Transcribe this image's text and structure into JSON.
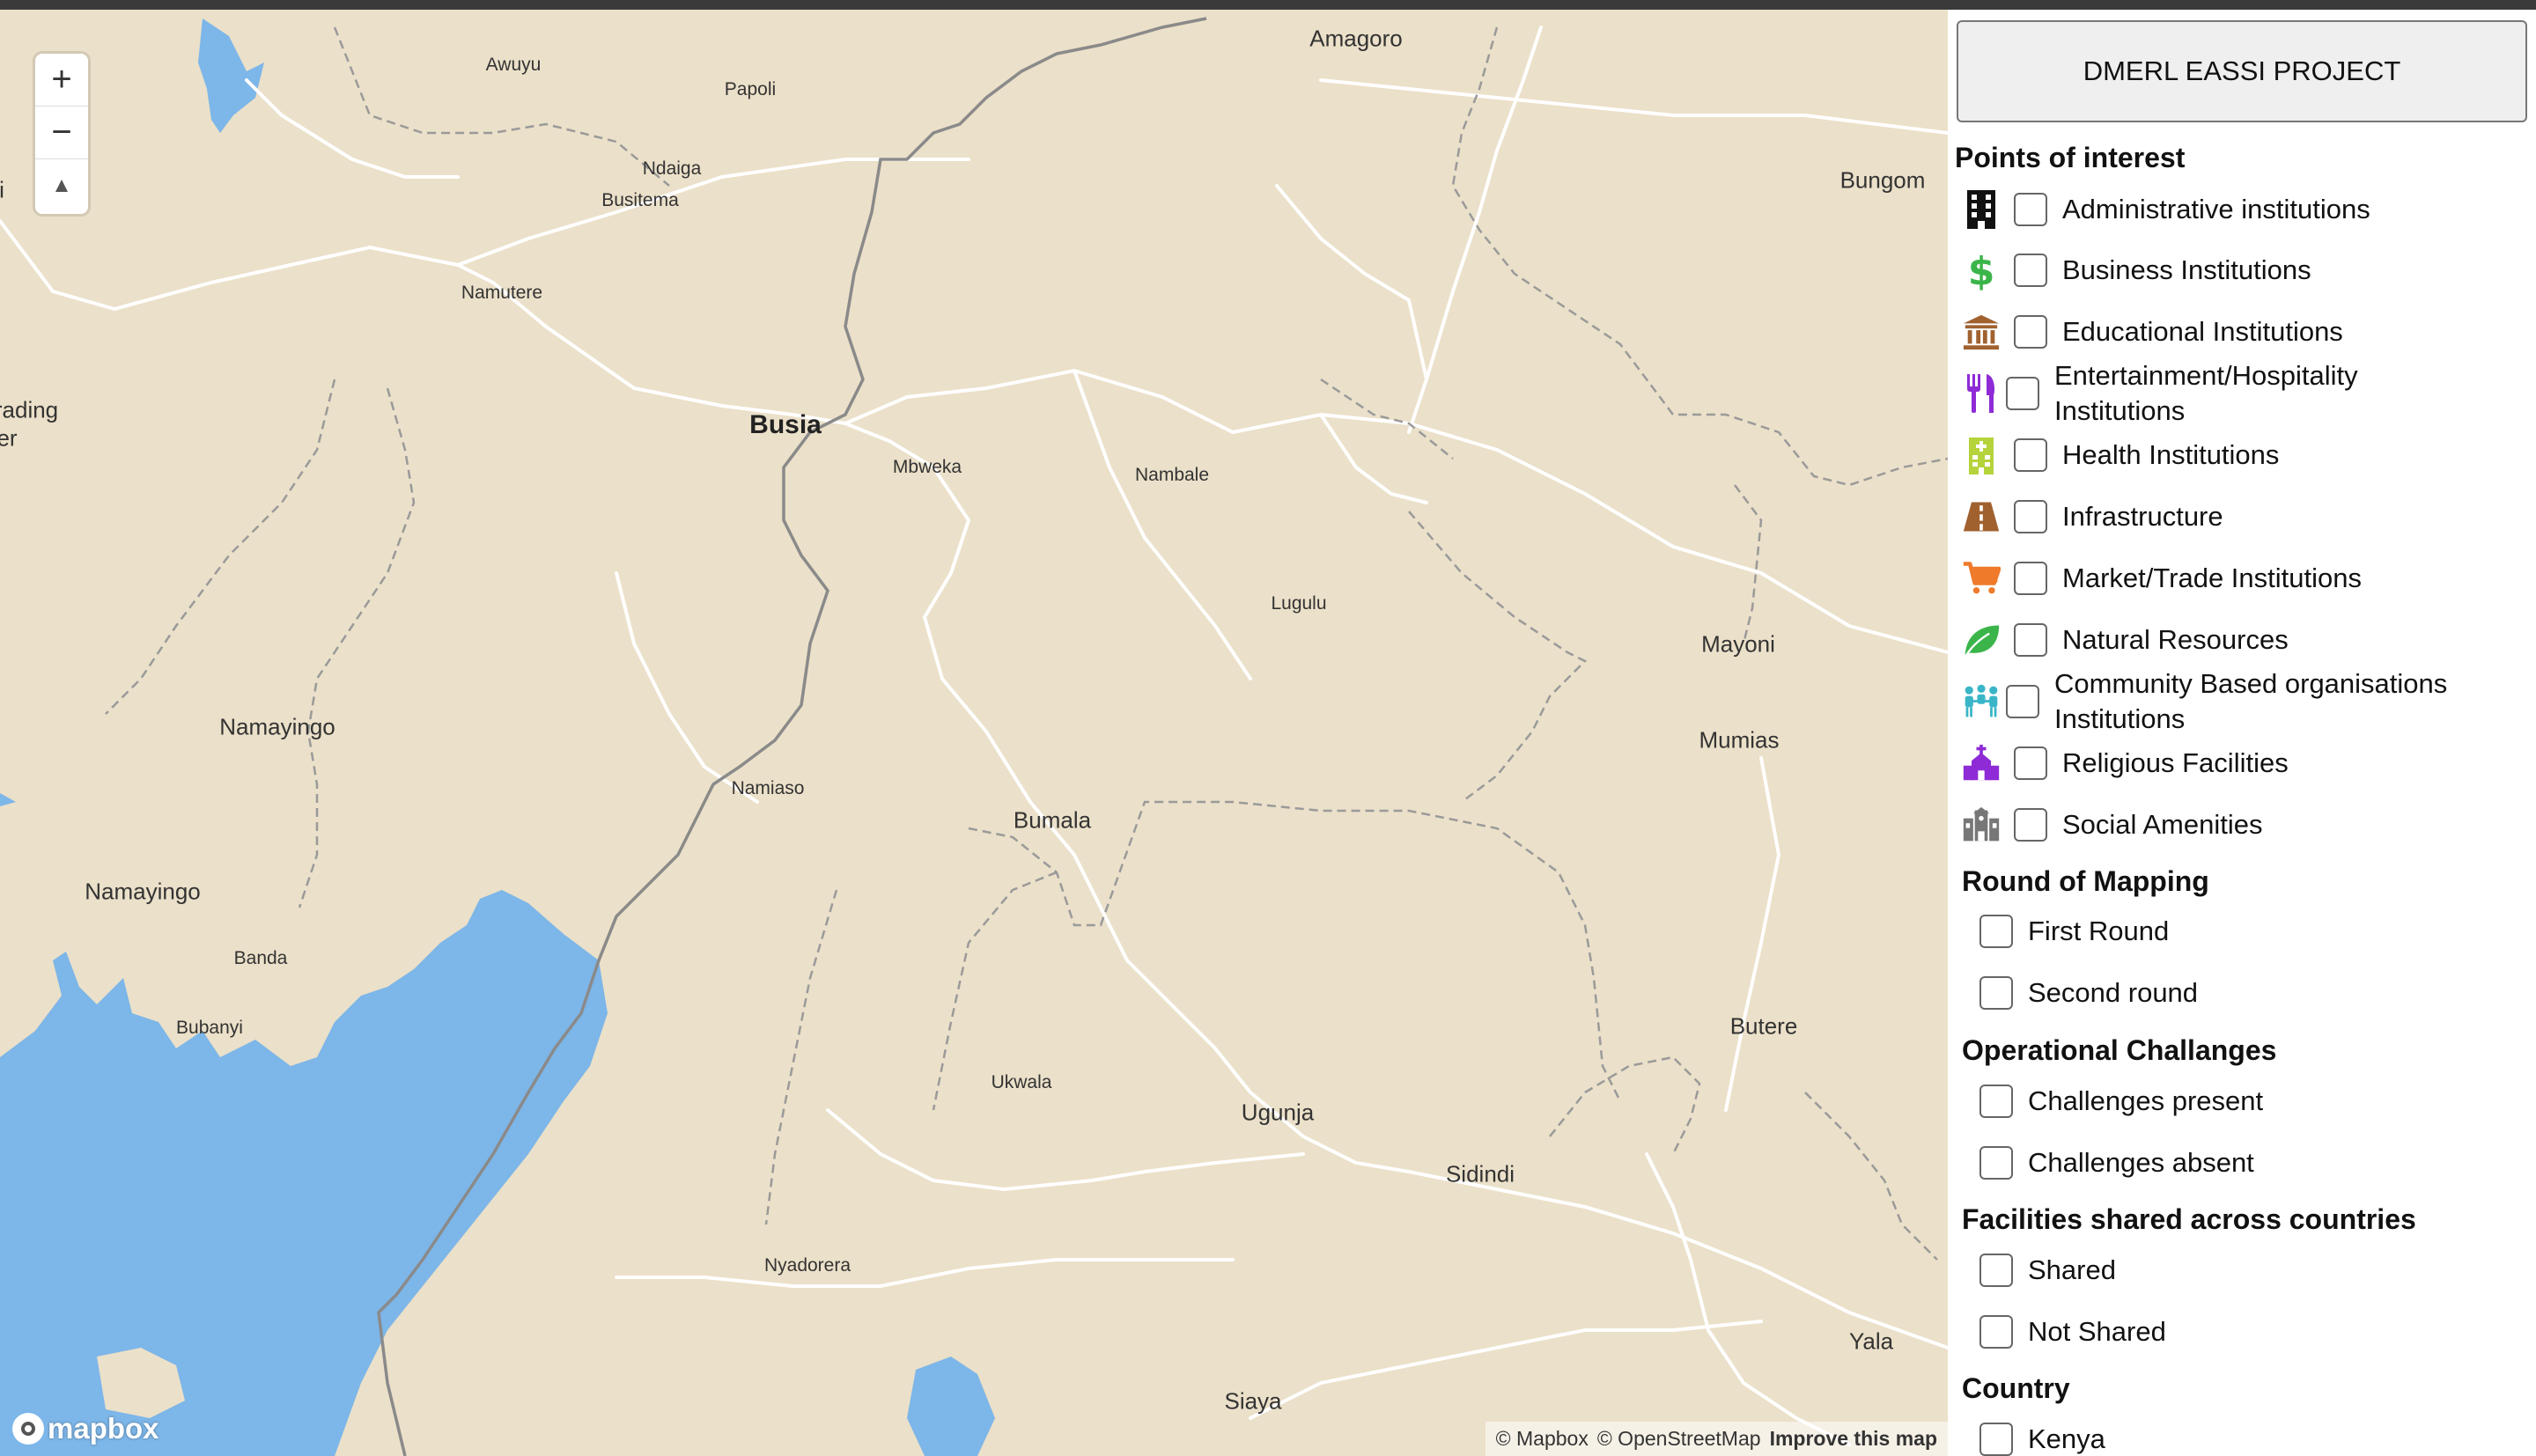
{
  "map": {
    "places": [
      {
        "name": "Amagoro",
        "size": "md"
      },
      {
        "name": "Awuyu",
        "size": "sm"
      },
      {
        "name": "Papoli",
        "size": "sm"
      },
      {
        "name": "Ndaiga",
        "size": "sm"
      },
      {
        "name": "Busitema",
        "size": "sm"
      },
      {
        "name": "Namutere",
        "size": "sm"
      },
      {
        "name": "Bungom",
        "size": "md"
      },
      {
        "name": "rading",
        "size": "md"
      },
      {
        "name": "er",
        "size": "md"
      },
      {
        "name": "Busia",
        "size": "lg"
      },
      {
        "name": "Mbweka",
        "size": "sm"
      },
      {
        "name": "Nambale",
        "size": "sm"
      },
      {
        "name": "Lugulu",
        "size": "sm"
      },
      {
        "name": "Mayoni",
        "size": "md"
      },
      {
        "name": "Mumias",
        "size": "md"
      },
      {
        "name": "Namayingo",
        "size": "md"
      },
      {
        "name": "Namiaso",
        "size": "sm"
      },
      {
        "name": "Bumala",
        "size": "md"
      },
      {
        "name": "Namayingo",
        "size": "md"
      },
      {
        "name": "Banda",
        "size": "sm"
      },
      {
        "name": "Bubanyi",
        "size": "sm"
      },
      {
        "name": "Butere",
        "size": "md"
      },
      {
        "name": "Ukwala",
        "size": "sm"
      },
      {
        "name": "Ugunja",
        "size": "md"
      },
      {
        "name": "Sidindi",
        "size": "md"
      },
      {
        "name": "Nyadorera",
        "size": "sm"
      },
      {
        "name": "Yala",
        "size": "md"
      },
      {
        "name": "Siaya",
        "size": "md"
      },
      {
        "name": "i",
        "size": "md"
      }
    ],
    "zoom_in": "+",
    "zoom_out": "−",
    "compass": "▲",
    "logo_text": "mapbox",
    "attribution": [
      "© Mapbox",
      "© OpenStreetMap",
      "Improve this map"
    ],
    "colors": {
      "land": "#ebe0c9",
      "water": "#7db6e8",
      "road": "#ffffff",
      "border": "#8a8a8a",
      "admin": "#9a9a9a"
    }
  },
  "panel": {
    "title": "DMERL EASSI PROJECT",
    "sections": [
      {
        "heading": "Points of interest",
        "items": [
          {
            "label": "Administrative institutions",
            "icon": "building-icon",
            "color": "#111111"
          },
          {
            "label": "Business Institutions",
            "icon": "dollar-icon",
            "color": "#3bb54a"
          },
          {
            "label": "Educational Institutions",
            "icon": "landmark-icon",
            "color": "#a0612f"
          },
          {
            "label": "Entertainment/Hospitality",
            "label2": "Institutions",
            "icon": "utensils-icon",
            "color": "#8e2bd6"
          },
          {
            "label": "Health Institutions",
            "icon": "hospital-icon",
            "color": "#b5d33a"
          },
          {
            "label": "Infrastructure",
            "icon": "road-icon",
            "color": "#a0612f"
          },
          {
            "label": "Market/Trade Institutions",
            "icon": "cart-icon",
            "color": "#ee7a2a"
          },
          {
            "label": "Natural Resources",
            "icon": "leaf-icon",
            "color": "#3bb54a"
          },
          {
            "label": "Community Based organisations",
            "label2": "Institutions",
            "icon": "people-icon",
            "color": "#3ab5c8"
          },
          {
            "label": "Religious Facilities",
            "icon": "church-icon",
            "color": "#8e2bd6"
          },
          {
            "label": "Social Amenities",
            "icon": "school-icon",
            "color": "#777777"
          }
        ]
      },
      {
        "heading": "Round of Mapping",
        "items": [
          {
            "label": "First Round"
          },
          {
            "label": "Second round"
          }
        ]
      },
      {
        "heading": "Operational Challanges",
        "items": [
          {
            "label": "Challenges present"
          },
          {
            "label": "Challenges absent"
          }
        ]
      },
      {
        "heading": "Facilities shared across countries",
        "items": [
          {
            "label": "Shared"
          },
          {
            "label": "Not Shared"
          }
        ]
      },
      {
        "heading": "Country",
        "items": [
          {
            "label": "Kenya"
          }
        ]
      }
    ]
  }
}
